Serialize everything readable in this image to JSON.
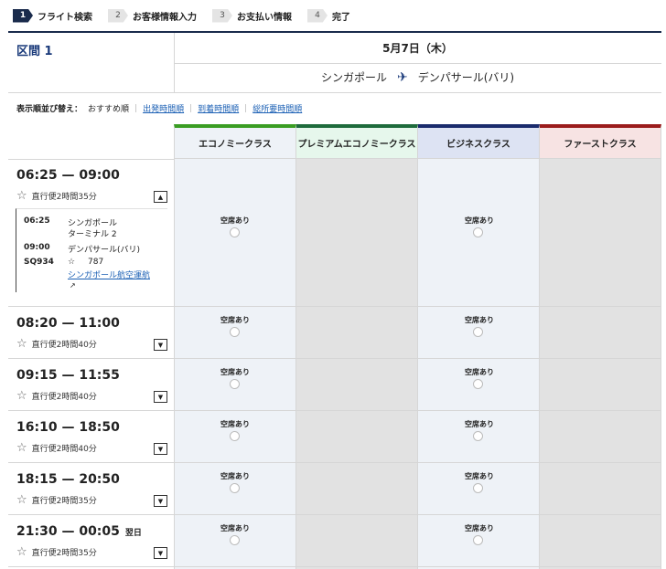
{
  "steps": [
    {
      "num": "1",
      "label": "フライト検索"
    },
    {
      "num": "2",
      "label": "お客様情報入力"
    },
    {
      "num": "3",
      "label": "お支払い情報"
    },
    {
      "num": "4",
      "label": "完了"
    }
  ],
  "segment": {
    "label": "区間 1",
    "date": "5月7日（木）",
    "origin": "シンガポール",
    "destination": "デンパサール(バリ)"
  },
  "sort": {
    "label": "表示順並び替え：",
    "current": "おすすめ順",
    "options": [
      "出発時間順",
      "到着時間順",
      "総所要時間順"
    ]
  },
  "classes": [
    {
      "name": "エコノミークラス",
      "color": "#3a9d23",
      "bg": "#eef2f7"
    },
    {
      "name": "プレミアムエコノミークラス",
      "color": "#1e6b3c",
      "bg": "#e6f7ec"
    },
    {
      "name": "ビジネスクラス",
      "color": "#1a2b6c",
      "bg": "#dde3f3"
    },
    {
      "name": "ファーストクラス",
      "color": "#9b1b1b",
      "bg": "#f7e3e3"
    }
  ],
  "availability_label": "空席あり",
  "flights": [
    {
      "dep": "06:25",
      "arr": "09:00",
      "next_day": "",
      "duration": "直行便2時間35分",
      "toggle": "▲"
    },
    {
      "dep": "08:20",
      "arr": "11:00",
      "next_day": "",
      "duration": "直行便2時間40分",
      "toggle": "▼"
    },
    {
      "dep": "09:15",
      "arr": "11:55",
      "next_day": "",
      "duration": "直行便2時間40分",
      "toggle": "▼"
    },
    {
      "dep": "16:10",
      "arr": "18:50",
      "next_day": "",
      "duration": "直行便2時間40分",
      "toggle": "▼"
    },
    {
      "dep": "18:15",
      "arr": "20:50",
      "next_day": "",
      "duration": "直行便2時間35分",
      "toggle": "▼"
    },
    {
      "dep": "21:30",
      "arr": "00:05",
      "next_day": "翌日",
      "duration": "直行便2時間35分",
      "toggle": "▼"
    }
  ],
  "detail": {
    "dep_time": "06:25",
    "dep_airport": "シンガポール",
    "dep_terminal": "ターミナル 2",
    "arr_time": "09:00",
    "arr_airport": "デンパサール(バリ)",
    "flight_no": "SQ934",
    "aircraft": "787",
    "carrier": "シンガポール航空運航"
  },
  "icons": {
    "star": "star-alliance-icon",
    "plane": "airplane-icon",
    "external": "external-link-icon"
  }
}
